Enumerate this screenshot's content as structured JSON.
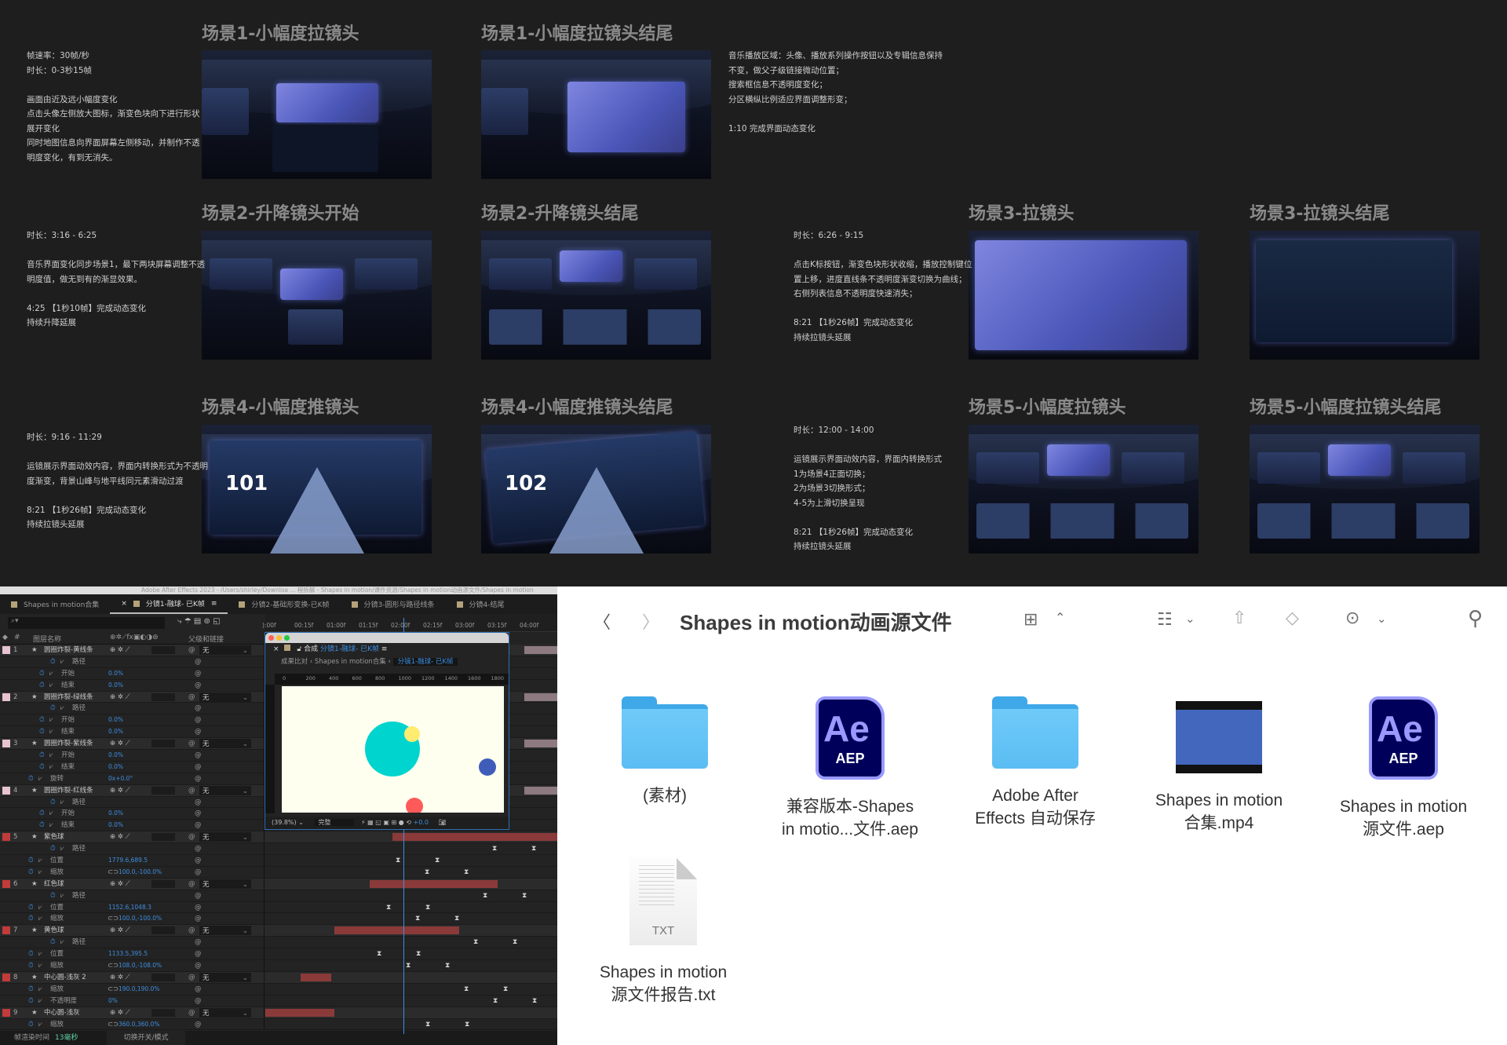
{
  "scenes": [
    {
      "title": "场景1-小幅度拉镜头",
      "variant": "s1"
    },
    {
      "title": "场景1-小幅度拉镜头结尾",
      "variant": "s1e"
    },
    {
      "title": "场景2-升降镜头开始",
      "variant": "s2"
    },
    {
      "title": "场景2-升降镜头结尾",
      "variant": "s2e"
    },
    {
      "title": "场景3-拉镜头",
      "variant": "s3"
    },
    {
      "title": "场景3-拉镜头结尾",
      "variant": "s3e"
    },
    {
      "title": "场景4-小幅度推镜头",
      "variant": "s4",
      "number": "101"
    },
    {
      "title": "场景4-小幅度推镜头结尾",
      "variant": "s4e",
      "number": "102"
    },
    {
      "title": "场景5-小幅度拉镜头",
      "variant": "s5"
    },
    {
      "title": "场景5-小幅度拉镜头结尾",
      "variant": "s5e"
    }
  ],
  "notes": [
    [
      "帧速率：30帧/秒",
      "时长：0-3秒15帧",
      "",
      "画面由近及远小幅度变化",
      "点击头像左侧放大图标，渐变色块向下进行形状",
      "展开变化",
      "同时地图信息向界面屏幕左侧移动，并制作不透",
      "明度变化，有到无消失。"
    ],
    [
      "音乐播放区域：头像、播放系列操作按钮以及专辑信息保持",
      "不变，做父子级链接微动位置；",
      "搜索框信息不透明度变化；",
      "分区横纵比例适应界面调整形变；",
      "",
      "1:10 完成界面动态变化"
    ],
    [
      "时长：3:16 - 6:25",
      "",
      "音乐界面变化同步场景1，最下两块屏幕调整不透",
      "明度值，做无到有的渐显效果。",
      "",
      "4:25 【1秒10帧】完成动态变化",
      "持续升降延展"
    ],
    [
      "时长：6:26 - 9:15",
      "",
      "点击K标按钮，渐变色块形状收缩，播放控制键位",
      "置上移，进度直线条不透明度渐变切换为曲线；",
      "右侧列表信息不透明度快速消失；",
      "",
      "8:21 【1秒26帧】完成动态变化",
      "持续拉镜头延展"
    ],
    [
      "时长：9:16 - 11:29",
      "",
      "运镜展示界面动效内容，界面内转换形式为不透明",
      "度渐变，背景山峰与地平线同元素滑动过渡",
      "",
      "8:21 【1秒26帧】完成动态变化",
      "持续拉镜头延展"
    ],
    [
      "时长：12:00 - 14:00",
      "",
      "运镜展示界面动效内容，界面内转换形式",
      "1为场景4正面切换；",
      "2为场景3切换形式；",
      "4-5为上滑切换呈现",
      "",
      "8:21 【1秒26帧】完成动态变化",
      "持续拉镜头延展"
    ]
  ],
  "ae": {
    "window_title": "Adobe After Effects 2023 - /Users/shirley/Downloa ... 程拆解 - Shapes in motion/课件资源/Shapes in motion动画源文件/Shapes in motion",
    "tabs": [
      "Shapes in motion合集",
      "分镜1-融球- 已K帧",
      "分镜2-基础形变换-已K帧",
      "分镜3-圆形与路径线条",
      "分镜4-结尾"
    ],
    "header": {
      "num": "#",
      "name": "图层名称",
      "parent": "父级和链接"
    },
    "parent_value": "无",
    "ruler": [
      "):00f",
      "00:15f",
      "01:00f",
      "01:15f",
      "02:00f",
      "02:15f",
      "03:00f",
      "03:15f",
      "04:00f"
    ],
    "rows": [
      {
        "t": "layer",
        "num": "1",
        "name": "圆圈炸裂-黄线条",
        "color": "#e8c3d2"
      },
      {
        "t": "prop",
        "name": "路径",
        "indent": 2
      },
      {
        "t": "prop",
        "name": "开始",
        "value": "0.0%",
        "indent": 1
      },
      {
        "t": "prop",
        "name": "结束",
        "value": "0.0%",
        "indent": 1
      },
      {
        "t": "layer",
        "num": "2",
        "name": "圆圈炸裂-绿线条",
        "color": "#e8c3d2"
      },
      {
        "t": "prop",
        "name": "路径",
        "indent": 2
      },
      {
        "t": "prop",
        "name": "开始",
        "value": "0.0%",
        "indent": 1
      },
      {
        "t": "prop",
        "name": "结束",
        "value": "0.0%",
        "indent": 1
      },
      {
        "t": "layer",
        "num": "3",
        "name": "圆圈炸裂-紫线条",
        "color": "#e8c3d2"
      },
      {
        "t": "prop",
        "name": "开始",
        "value": "0.0%",
        "indent": 1
      },
      {
        "t": "prop",
        "name": "结束",
        "value": "0.0%",
        "indent": 1
      },
      {
        "t": "prop",
        "name": "旋转",
        "value": "0x+0.0°",
        "indent": 0
      },
      {
        "t": "layer",
        "num": "4",
        "name": "圆圈炸裂-红线条",
        "color": "#e8c3d2"
      },
      {
        "t": "prop",
        "name": "路径",
        "indent": 2
      },
      {
        "t": "prop",
        "name": "开始",
        "value": "0.0%",
        "indent": 1
      },
      {
        "t": "prop",
        "name": "结束",
        "value": "0.0%",
        "indent": 1
      },
      {
        "t": "layer",
        "num": "5",
        "name": "紫色球",
        "color": "#c23b3b"
      },
      {
        "t": "prop",
        "name": "路径",
        "indent": 2
      },
      {
        "t": "prop",
        "name": "位置",
        "value": "1779.6,689.5",
        "indent": 0
      },
      {
        "t": "prop",
        "name": "缩放",
        "value": "100.0,-100.0%",
        "indent": 0,
        "link": true
      },
      {
        "t": "layer",
        "num": "6",
        "name": "红色球",
        "color": "#c23b3b"
      },
      {
        "t": "prop",
        "name": "路径",
        "indent": 2
      },
      {
        "t": "prop",
        "name": "位置",
        "value": "1152.6,1048.3",
        "indent": 0
      },
      {
        "t": "prop",
        "name": "缩放",
        "value": "100.0,-100.0%",
        "indent": 0,
        "link": true
      },
      {
        "t": "layer",
        "num": "7",
        "name": "黄色球",
        "color": "#c23b3b"
      },
      {
        "t": "prop",
        "name": "路径",
        "indent": 2
      },
      {
        "t": "prop",
        "name": "位置",
        "value": "1133.5,395.5",
        "indent": 0
      },
      {
        "t": "prop",
        "name": "缩放",
        "value": "108.0,-108.0%",
        "indent": 0,
        "link": true
      },
      {
        "t": "layer",
        "num": "8",
        "name": "中心圆-浅灰 2",
        "color": "#c23b3b"
      },
      {
        "t": "prop",
        "name": "缩放",
        "value": "190.0,190.0%",
        "indent": 0,
        "link": true
      },
      {
        "t": "prop",
        "name": "不透明度",
        "value": "0%",
        "indent": 0
      },
      {
        "t": "layer",
        "num": "9",
        "name": "中心圆-浅灰",
        "color": "#c23b3b"
      },
      {
        "t": "prop",
        "name": "缩放",
        "value": "360.0,360.0%",
        "indent": 0,
        "link": true
      }
    ],
    "comp": {
      "label": "合成",
      "name": "分镜1-融球- 已K帧",
      "breadcrumb": [
        "成果比对",
        "Shapes in motion合集",
        "分镜1-融球- 已K帧"
      ],
      "ruler": [
        "0",
        "200",
        "400",
        "600",
        "800",
        "1000",
        "1200",
        "1400",
        "1600",
        "1800"
      ],
      "zoom": "(39.8%)",
      "quality": "完整",
      "exposure": "+0.0"
    },
    "status": {
      "render_label": "帧渲染时间",
      "render_value": "13毫秒",
      "toggle_label": "切换开关/模式"
    }
  },
  "finder": {
    "title": "Shapes in motion动画源文件",
    "items": [
      {
        "kind": "folder",
        "lines": [
          "(素材)"
        ]
      },
      {
        "kind": "aep",
        "lines": [
          "兼容版本-Shapes",
          "in motio...文件.aep"
        ],
        "icon_text": "Ae",
        "ext": "AEP"
      },
      {
        "kind": "folder",
        "lines": [
          "Adobe After",
          "Effects 自动保存"
        ]
      },
      {
        "kind": "mp4",
        "lines": [
          "Shapes in motion",
          "合集.mp4"
        ]
      },
      {
        "kind": "aep",
        "lines": [
          "Shapes in motion",
          "源文件.aep"
        ],
        "icon_text": "Ae",
        "ext": "AEP"
      },
      {
        "kind": "txt",
        "lines": [
          "Shapes in motion",
          "源文件报告.txt"
        ],
        "ext": "TXT"
      }
    ]
  },
  "colors": {
    "accent_blue": "#3d8ee0",
    "cyan_ball": "#00d4cf",
    "yellow_ball": "#ffec70",
    "blue_ball": "#3f5db8",
    "red_ball": "#ff5a5a",
    "layer_bar": "#8b3a3a"
  }
}
